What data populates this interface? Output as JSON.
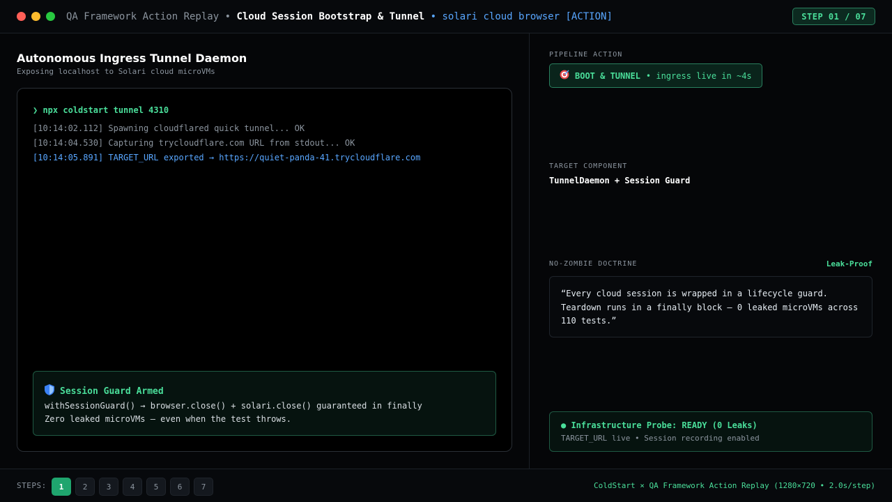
{
  "window": {
    "title_prefix": "QA Framework Action Replay •",
    "title_main": "Cloud Session Bootstrap & Tunnel",
    "title_suffix": "• solari cloud browser [ACTION]",
    "step_badge": "STEP 01 / 07"
  },
  "left": {
    "heading": "Autonomous Ingress Tunnel Daemon",
    "subheading": "Exposing localhost to Solari cloud microVMs",
    "terminal": {
      "command": "❯ npx coldstart tunnel 4310",
      "logs": [
        "[10:14:02.112] Spawning cloudflared quick tunnel... OK",
        "[10:14:04.530] Capturing trycloudflare.com URL from stdout... OK",
        "[10:14:05.891] TARGET_URL exported → https://quiet-panda-41.trycloudflare.com"
      ]
    },
    "guard": {
      "title": "Session Guard Armed",
      "line1": "withSessionGuard() → browser.close() + solari.close() guaranteed in finally",
      "line2": "Zero leaked microVMs — even when the test throws."
    }
  },
  "right": {
    "pipeline_label": "PIPELINE ACTION",
    "pipeline_action": "BOOT & TUNNEL",
    "pipeline_detail": "• ingress live in ~4s",
    "target_label": "TARGET COMPONENT",
    "target_name": "TunnelDaemon + Session Guard",
    "doctrine_label": "NO-ZOMBIE DOCTRINE",
    "doctrine_tag": "Leak-Proof",
    "quote": "“Every cloud session is wrapped in a lifecycle guard. Teardown runs in a finally block — 0 leaked microVMs across 110 tests.”",
    "probe_title": "● Infrastructure Probe: READY (0 Leaks)",
    "probe_sub": "TARGET_URL live • Session recording enabled"
  },
  "footer": {
    "steps_label": "STEPS:",
    "steps": [
      "1",
      "2",
      "3",
      "4",
      "5",
      "6",
      "7"
    ],
    "active_step": 1,
    "right_text": "ColdStart × QA Framework Action Replay (1280×720 • 2.0s/step)"
  },
  "icons": {
    "target": "target-icon",
    "shield": "shield-icon"
  }
}
